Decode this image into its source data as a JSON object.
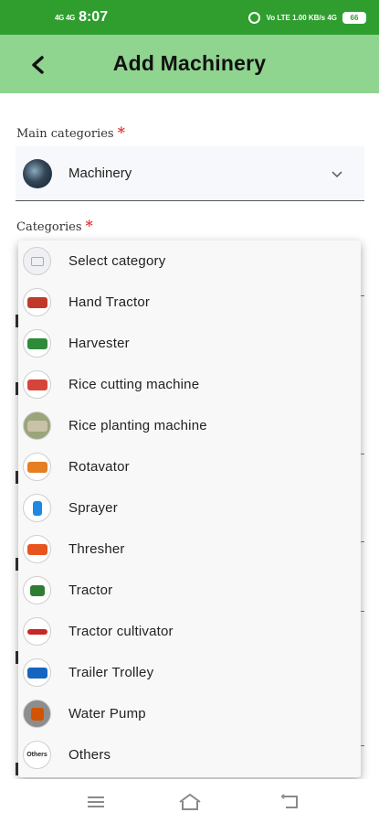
{
  "status_bar": {
    "network": "4G 4G",
    "time": "8:07",
    "signal_info": "Vo LTE 1.00 KB/s 4G",
    "battery": "66"
  },
  "app_bar": {
    "back_icon": "arrow-left-icon",
    "title": "Add Machinery"
  },
  "form": {
    "main_categories_label": "Main categories",
    "required_mark": "*",
    "main_category_value": "Machinery",
    "categories_label": "Categories"
  },
  "dropdown": {
    "options": [
      {
        "label": "Select category",
        "icon": "image-placeholder-icon"
      },
      {
        "label": "Hand Tractor",
        "icon": "hand-tractor-icon"
      },
      {
        "label": "Harvester",
        "icon": "harvester-icon"
      },
      {
        "label": "Rice cutting machine",
        "icon": "rice-cutting-machine-icon"
      },
      {
        "label": "Rice planting machine",
        "icon": "rice-planting-machine-icon"
      },
      {
        "label": "Rotavator",
        "icon": "rotavator-icon"
      },
      {
        "label": "Sprayer",
        "icon": "sprayer-icon"
      },
      {
        "label": "Thresher",
        "icon": "thresher-icon"
      },
      {
        "label": "Tractor",
        "icon": "tractor-icon"
      },
      {
        "label": "Tractor cultivator",
        "icon": "tractor-cultivator-icon"
      },
      {
        "label": "Trailer Trolley",
        "icon": "trailer-trolley-icon"
      },
      {
        "label": "Water Pump",
        "icon": "water-pump-icon"
      },
      {
        "label": "Others",
        "icon": "others-icon",
        "icon_text": "Others"
      }
    ]
  },
  "nav_bar": {
    "icons": [
      "menu-icon",
      "home-icon",
      "back-icon"
    ]
  },
  "colors": {
    "status_bar": "#2f9e2f",
    "app_bar": "#8fd48f",
    "required": "#e53935"
  }
}
